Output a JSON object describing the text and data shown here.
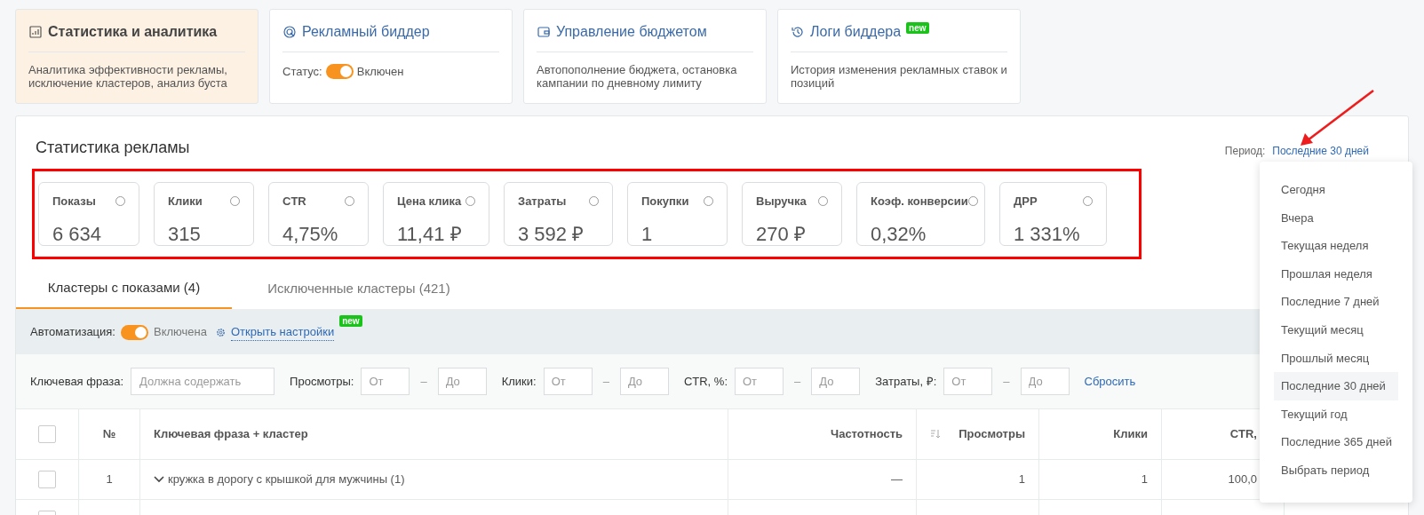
{
  "feature_cards": [
    {
      "kind": "stats",
      "title": "Статистика и аналитика",
      "selected": true,
      "description": "Аналитика эффективности рекламы, исключение кластеров, анализ буста"
    },
    {
      "kind": "bidder",
      "title": "Рекламный биддер",
      "selected": false,
      "status_label": "Статус:",
      "status_on": true,
      "status_text": "Включен"
    },
    {
      "kind": "budget",
      "title": "Управление бюджетом",
      "selected": false,
      "description": "Автопополнение бюджета, остановка кампании по дневному лимиту"
    },
    {
      "kind": "logs",
      "title": "Логи биддера",
      "selected": false,
      "badge": "new",
      "description": "История изменения рекламных ставок и позиций"
    }
  ],
  "stats_panel": {
    "title": "Статистика рекламы",
    "period_label": "Период:",
    "period_value": "Последние 30 дней",
    "metrics": [
      {
        "label": "Показы",
        "value": "6 634"
      },
      {
        "label": "Клики",
        "value": "315"
      },
      {
        "label": "CTR",
        "value": "4,75%"
      },
      {
        "label": "Цена клика",
        "value": "11,41 ₽"
      },
      {
        "label": "Затраты",
        "value": "3 592 ₽"
      },
      {
        "label": "Покупки",
        "value": "1"
      },
      {
        "label": "Выручка",
        "value": "270 ₽"
      },
      {
        "label": "Коэф. конверсии",
        "value": "0,32%"
      },
      {
        "label": "ДРР",
        "value": "1 331%"
      }
    ]
  },
  "tabs": [
    {
      "label": "Кластеры с показами (4)",
      "selected": true
    },
    {
      "label": "Исключенные кластеры (421)",
      "selected": false
    }
  ],
  "automation": {
    "label": "Автоматизация:",
    "on": true,
    "state_text": "Включена",
    "settings_link": "Открыть настройки",
    "badge": "new"
  },
  "filters": {
    "keyword_label": "Ключевая фраза:",
    "keyword_placeholder": "Должна содержать",
    "ranges": [
      {
        "label": "Просмотры:",
        "from_placeholder": "От",
        "to_placeholder": "До"
      },
      {
        "label": "Клики:",
        "from_placeholder": "От",
        "to_placeholder": "До"
      },
      {
        "label": "CTR, %:",
        "from_placeholder": "От",
        "to_placeholder": "До"
      },
      {
        "label": "Затраты, ₽:",
        "from_placeholder": "От",
        "to_placeholder": "До"
      }
    ],
    "separator": "–",
    "reset": "Сбросить"
  },
  "table": {
    "header_checked": false,
    "columns": [
      "№",
      "Ключевая фраза + кластер",
      "Частотность",
      "Просмотры",
      "Клики",
      "CTR, "
    ],
    "rows": [
      {
        "checked": false,
        "cells": [
          "1",
          "кружка в дорогу с крышкой для мужчины (1)",
          "—",
          "1",
          "1",
          "100,0"
        ]
      },
      {
        "checked": false,
        "cells": []
      }
    ]
  },
  "period_dropdown": {
    "items": [
      {
        "label": "Сегодня",
        "selected": false
      },
      {
        "label": "Вчера",
        "selected": false
      },
      {
        "label": "Текущая неделя",
        "selected": false
      },
      {
        "label": "Прошлая неделя",
        "selected": false
      },
      {
        "label": "Последние 7 дней",
        "selected": false
      },
      {
        "label": "Текущий месяц",
        "selected": false
      },
      {
        "label": "Прошлый месяц",
        "selected": false
      },
      {
        "label": "Последние 30 дней",
        "selected": true
      },
      {
        "label": "Текущий год",
        "selected": false
      },
      {
        "label": "Последние 365 дней",
        "selected": false
      },
      {
        "label": "Выбрать период",
        "selected": false
      }
    ]
  }
}
